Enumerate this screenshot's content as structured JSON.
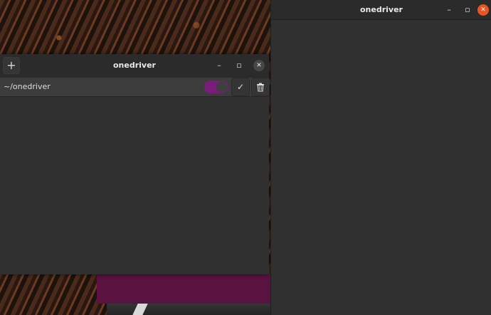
{
  "left_window": {
    "title": "onedriver",
    "add_icon": "+",
    "minimize_icon": "–",
    "maximize_icon": "▫",
    "close_icon": "✕",
    "mount_row": {
      "path": "~/onedriver",
      "toggle_on": true,
      "check_icon": "✓",
      "trash_icon": "🗑"
    }
  },
  "right_window": {
    "title": "onedriver",
    "minimize_icon": "–",
    "maximize_icon": "▫",
    "close_icon": "✕"
  },
  "colors": {
    "toggle_accent": "#7b1c7b",
    "close_accent": "#e95420",
    "window_bg": "#303030"
  }
}
